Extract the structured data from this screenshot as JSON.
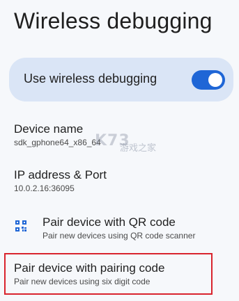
{
  "header": {
    "title": "Wireless debugging"
  },
  "toggle": {
    "label": "Use wireless debugging",
    "state": "on",
    "accent": "#1f66d6"
  },
  "settings": {
    "device_name": {
      "title": "Device name",
      "value": "sdk_gphone64_x86_64"
    },
    "ip": {
      "title": "IP address & Port",
      "value": "10.0.2.16:36095"
    },
    "qr": {
      "title": "Pair device with QR code",
      "subtitle": "Pair new devices using QR code scanner",
      "icon": "qr-code-scanner-icon"
    },
    "pairing": {
      "title": "Pair device with pairing code",
      "subtitle": "Pair new devices using six digit code",
      "highlight_color": "#d9232d"
    }
  },
  "watermark": {
    "logo": "K73",
    "text": "游戏之家"
  }
}
